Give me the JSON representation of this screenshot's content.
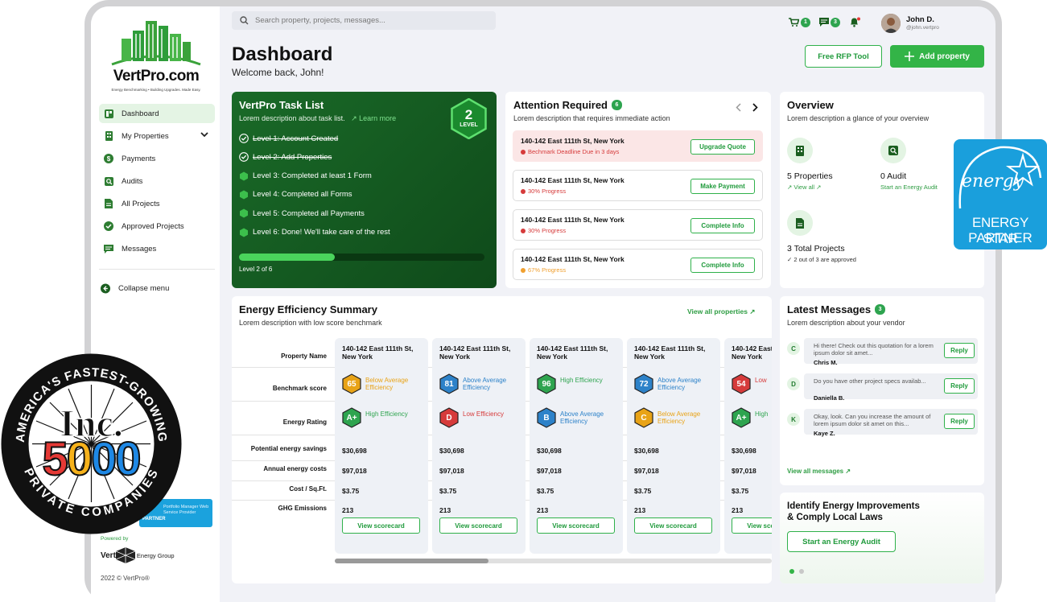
{
  "brand": {
    "name": "VertPro.com",
    "tagline": "Energy Benchmarking • Building Upgrades. Made Easy.",
    "accent": "#33b447"
  },
  "sidebar": {
    "items": [
      {
        "label": "Dashboard",
        "icon": "dashboard-icon",
        "active": true
      },
      {
        "label": "My Properties",
        "icon": "building-icon"
      },
      {
        "label": "Payments",
        "icon": "dollar-icon"
      },
      {
        "label": "Audits",
        "icon": "search-icon"
      },
      {
        "label": "All Projects",
        "icon": "document-icon"
      },
      {
        "label": "Approved Projects",
        "icon": "check-circle-icon"
      },
      {
        "label": "Messages",
        "icon": "message-icon"
      }
    ],
    "collapse": "Collapse menu",
    "partner_text": "Portfolio Manager Web Service Provider",
    "partner_word": "PARTNER",
    "powered_by": "Powered by",
    "energy_group_left": "Vert",
    "energy_group_right": "Energy Group",
    "copyright": "2022 © VertPro®"
  },
  "header": {
    "search_placeholder": "Search property, projects, messages...",
    "cart_count": "1",
    "messages_count": "3",
    "user_name": "John D.",
    "user_handle": "@john.vertpro"
  },
  "page": {
    "title": "Dashboard",
    "subtitle": "Welcome back, John!",
    "rfp_button": "Free RFP Tool",
    "add_button": "Add property"
  },
  "task_list": {
    "title": "VertPro Task List",
    "desc": "Lorem description about task list.",
    "learn_more": "Learn more",
    "level_num": "2",
    "level_word": "LEVEL",
    "levels": [
      {
        "label": "Level 1: Account Created",
        "done": true
      },
      {
        "label": "Level 2: Add Properties",
        "done": true
      },
      {
        "label": "Level 3: Completed at least 1 Form",
        "done": false
      },
      {
        "label": "Level 4: Completed all Forms",
        "done": false
      },
      {
        "label": "Level 5: Completed all Payments",
        "done": false
      },
      {
        "label": "Level 6: Done! We'll take care of the rest",
        "done": false
      }
    ],
    "progress": 0.39,
    "progress_label": "Level 2 of 6"
  },
  "attention": {
    "title": "Attention Required",
    "count": "6",
    "desc": "Lorem description that requires immediate action",
    "rows": [
      {
        "address": "140-142 East 111th St, New York",
        "status": "Bechmark Deadline Due in 3 days",
        "status_color": "#d63b3b",
        "button": "Upgrade Quote",
        "alert": true
      },
      {
        "address": "140-142 East 111th St, New York",
        "status": "30% Progress",
        "status_color": "#d63b3b",
        "button": "Make Payment",
        "alert": false
      },
      {
        "address": "140-142 East 111th St, New York",
        "status": "30% Progress",
        "status_color": "#d63b3b",
        "button": "Complete Info",
        "alert": false
      },
      {
        "address": "140-142 East 111th St, New York",
        "status": "67% Progress",
        "status_color": "#f0a030",
        "button": "Complete Info",
        "alert": false
      }
    ]
  },
  "overview": {
    "title": "Overview",
    "desc": "Lorem description a glance of your overview",
    "properties": "5 Properties",
    "view_all": "View all",
    "audit": "0 Audit",
    "audit_link": "Start an Energy Audit",
    "projects": "3 Total Projects",
    "projects_sub": "2 out of 3 are approved"
  },
  "efficiency": {
    "title": "Energy Efficiency Summary",
    "desc": "Lorem description with low score benchmark",
    "view_all": "View all properties",
    "row_labels": [
      "Property Name",
      "Benchmark score",
      "Energy Rating",
      "Potential energy savings",
      "Annual energy costs",
      "Cost / Sq.Ft.",
      "GHG Emissions"
    ],
    "columns": [
      {
        "name": "140-142 East 111th St, New York",
        "score": "65",
        "score_text": "Below Average Efficiency",
        "score_color": "#e8a317",
        "rating": "A+",
        "rating_text": "High Efficiency",
        "rating_color": "#2ea44f",
        "savings": "$30,698",
        "costs": "$97,018",
        "cost_sqft": "$3.75",
        "ghg": "213",
        "button": "View scorecard"
      },
      {
        "name": "140-142 East 111th St, New York",
        "score": "81",
        "score_text": "Above Average Efficiency",
        "score_color": "#2d82c9",
        "rating": "D",
        "rating_text": "Low Efficiency",
        "rating_color": "#d63b3b",
        "savings": "$30,698",
        "costs": "$97,018",
        "cost_sqft": "$3.75",
        "ghg": "213",
        "button": "View scorecard"
      },
      {
        "name": "140-142 East 111th St, New York",
        "score": "96",
        "score_text": "High Efficiency",
        "score_color": "#2ea44f",
        "rating": "B",
        "rating_text": "Above Average Efficiency",
        "rating_color": "#2d82c9",
        "savings": "$30,698",
        "costs": "$97,018",
        "cost_sqft": "$3.75",
        "ghg": "213",
        "button": "View scorecard"
      },
      {
        "name": "140-142 East 111th St, New York",
        "score": "72",
        "score_text": "Above Average Efficiency",
        "score_color": "#2d82c9",
        "rating": "C",
        "rating_text": "Below Average Efficiency",
        "rating_color": "#e8a317",
        "savings": "$30,698",
        "costs": "$97,018",
        "cost_sqft": "$3.75",
        "ghg": "213",
        "button": "View scorecard"
      },
      {
        "name": "140-142 East 111th St, New York",
        "score": "54",
        "score_text": "Low",
        "score_color": "#d63b3b",
        "rating": "A+",
        "rating_text": "High",
        "rating_color": "#2ea44f",
        "savings": "$30,698",
        "costs": "$97,018",
        "cost_sqft": "$3.75",
        "ghg": "213",
        "button": "View scorecard"
      }
    ]
  },
  "messages": {
    "title": "Latest Messages",
    "count": "3",
    "desc": "Lorem description about your vendor",
    "items": [
      {
        "initial": "C",
        "text": "Hi there! Check out this quotation for a lorem ipsum dolor sit amet...",
        "name": "Chris M.",
        "button": "Reply"
      },
      {
        "initial": "D",
        "text": "Do you have other project specs availab...",
        "name": "Daniella B.",
        "button": "Reply"
      },
      {
        "initial": "K",
        "text": "Okay, look. Can you increase the amount of lorem ipsum dolor sit amet on this...",
        "name": "Kaye Z.",
        "button": "Reply"
      }
    ],
    "view_all": "View all messages"
  },
  "improve": {
    "title1": "Identify Energy Improvements",
    "title2": "& Comply Local Laws",
    "button": "Start an Energy Audit"
  },
  "energy_star": {
    "script": "energy",
    "line1": "ENERGY STAR",
    "line2": "PARTNER"
  },
  "inc_badge": {
    "top": "AMERICA'S FASTEST-GROWING",
    "brand": "Inc.",
    "number": "5000",
    "bottom": "PRIVATE COMPANIES"
  }
}
